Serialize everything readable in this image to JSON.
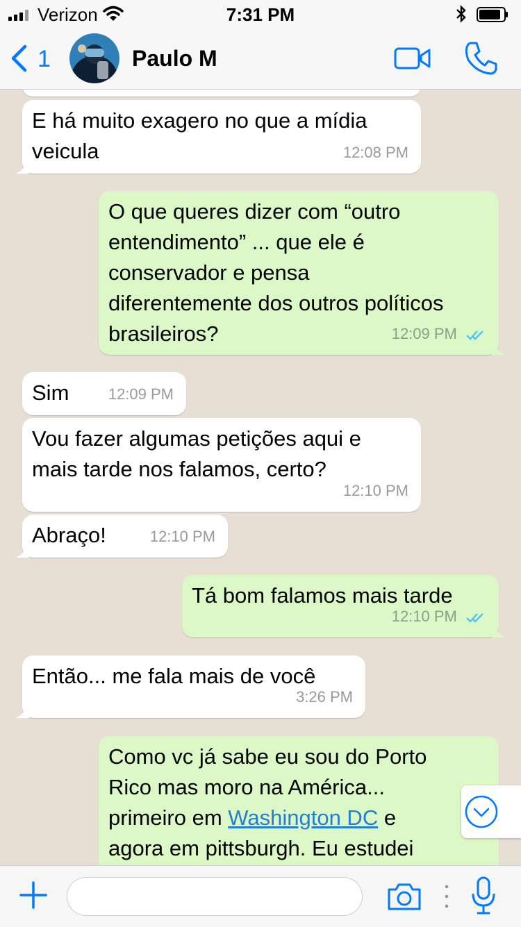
{
  "status_bar": {
    "carrier": "Verizon",
    "time": "7:31 PM"
  },
  "header": {
    "back_count": "1",
    "contact_name": "Paulo M"
  },
  "colors": {
    "accent": "#007aff",
    "outgoing": "#dcf8c6",
    "incoming": "#ffffff",
    "chat_bg": "#e7dfd4",
    "read_ticks": "#4fc3f7"
  },
  "icons": [
    "signal-icon",
    "wifi-icon",
    "bluetooth-icon",
    "battery-icon",
    "back-chevron-icon",
    "video-call-icon",
    "phone-icon",
    "chevron-down-icon",
    "plus-icon",
    "camera-icon",
    "microphone-icon"
  ],
  "messages": [
    {
      "dir": "in",
      "text": "E há muito exagero no que a mídia\nveicula",
      "time": "12:08 PM"
    },
    {
      "dir": "out",
      "text": "O que queres dizer com “outro\nentendimento” ... que ele é\nconservador e pensa\ndiferentemente dos outros políticos\nbrasileiros?",
      "time": "12:09 PM"
    },
    {
      "dir": "in",
      "text": "Sim",
      "time": "12:09 PM"
    },
    {
      "dir": "in",
      "text": "Vou fazer algumas petições aqui e\nmais tarde nos falamos, certo?",
      "time": "12:10 PM"
    },
    {
      "dir": "in",
      "text": "Abraço!",
      "time": "12:10 PM"
    },
    {
      "dir": "out",
      "text": "Tá bom falamos mais tarde",
      "time": "12:10 PM"
    },
    {
      "dir": "in",
      "text": "Então... me fala mais de você",
      "time": "3:26 PM"
    },
    {
      "dir": "out",
      "text_before": "Como vc já sabe eu sou do Porto\nRico mas moro na América...\nprimeiro em ",
      "link": "Washington DC",
      "text_after": " e\nagora em pittsburgh. Eu estudei"
    }
  ],
  "composer": {
    "value": "",
    "placeholder": ""
  }
}
